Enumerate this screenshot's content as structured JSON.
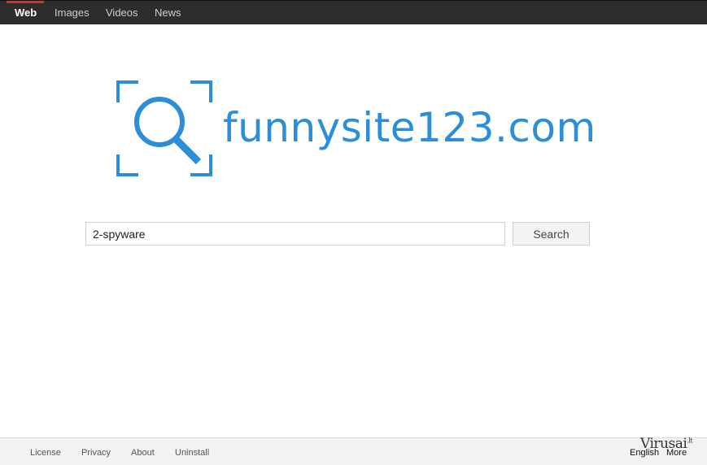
{
  "nav": {
    "items": [
      {
        "label": "Web",
        "active": true
      },
      {
        "label": "Images",
        "active": false
      },
      {
        "label": "Videos",
        "active": false
      },
      {
        "label": "News",
        "active": false
      }
    ]
  },
  "logo": {
    "text": "funnysite123.com",
    "color": "#2a8fd8"
  },
  "search": {
    "value": "2-spyware",
    "button_label": "Search"
  },
  "footer": {
    "links": [
      "License",
      "Privacy",
      "About",
      "Uninstall"
    ],
    "language": "English",
    "more": "More"
  },
  "watermark": {
    "text": "Virusai",
    "suffix": ".lt"
  },
  "colors": {
    "topbar": "#2d2d2d",
    "active_indicator": "#dd2a2a",
    "brand": "#2a8fd8"
  }
}
